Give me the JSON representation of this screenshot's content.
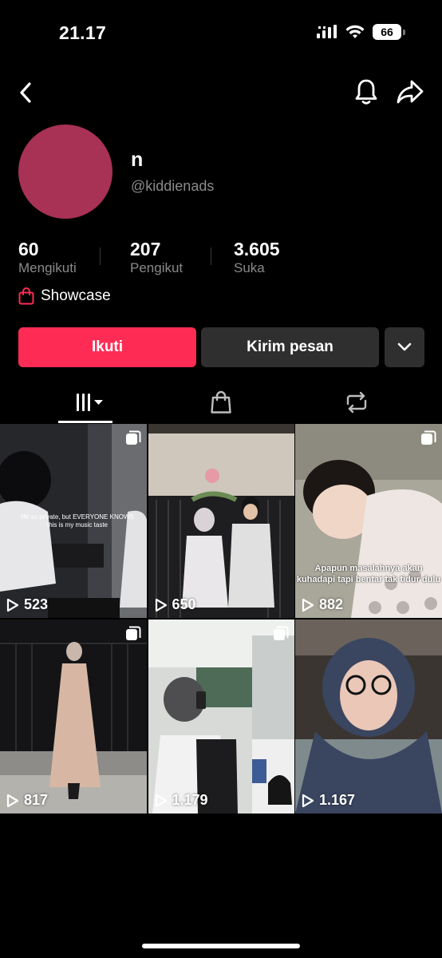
{
  "status": {
    "time": "21.17",
    "battery": "66"
  },
  "profile": {
    "display_name": "n",
    "username": "@kiddienads",
    "avatar_color": "#a83156"
  },
  "stats": [
    {
      "value": "60",
      "label": "Mengikuti"
    },
    {
      "value": "207",
      "label": "Pengikut"
    },
    {
      "value": "3.605",
      "label": "Suka"
    }
  ],
  "showcase": {
    "label": "Showcase",
    "icon": "shopping-bag-icon"
  },
  "actions": {
    "follow": "Ikuti",
    "message": "Kirim pesan",
    "more_icon": "chevron-down-icon"
  },
  "tabs": [
    {
      "name": "videos",
      "icon": "grid-icon",
      "active": true
    },
    {
      "name": "shop",
      "icon": "shopping-bag-icon",
      "active": false
    },
    {
      "name": "reposts",
      "icon": "repost-icon",
      "active": false
    }
  ],
  "videos": [
    {
      "views": "523",
      "caption": "life so private, but EVERYONE KNOWS this is my music taste",
      "multi": true
    },
    {
      "views": "650",
      "caption": "",
      "multi": false
    },
    {
      "views": "882",
      "caption": "Apapun masalahnya akan kuhadapi tapi bentar tak tidur dulu",
      "multi": true
    },
    {
      "views": "817",
      "caption": "",
      "multi": true
    },
    {
      "views": "1.179",
      "caption": "",
      "multi": true
    },
    {
      "views": "1.167",
      "caption": "",
      "multi": false
    }
  ],
  "colors": {
    "accent": "#fe2c55",
    "secondary_button": "#2f2f2f",
    "muted_text": "#8a8a8a"
  }
}
